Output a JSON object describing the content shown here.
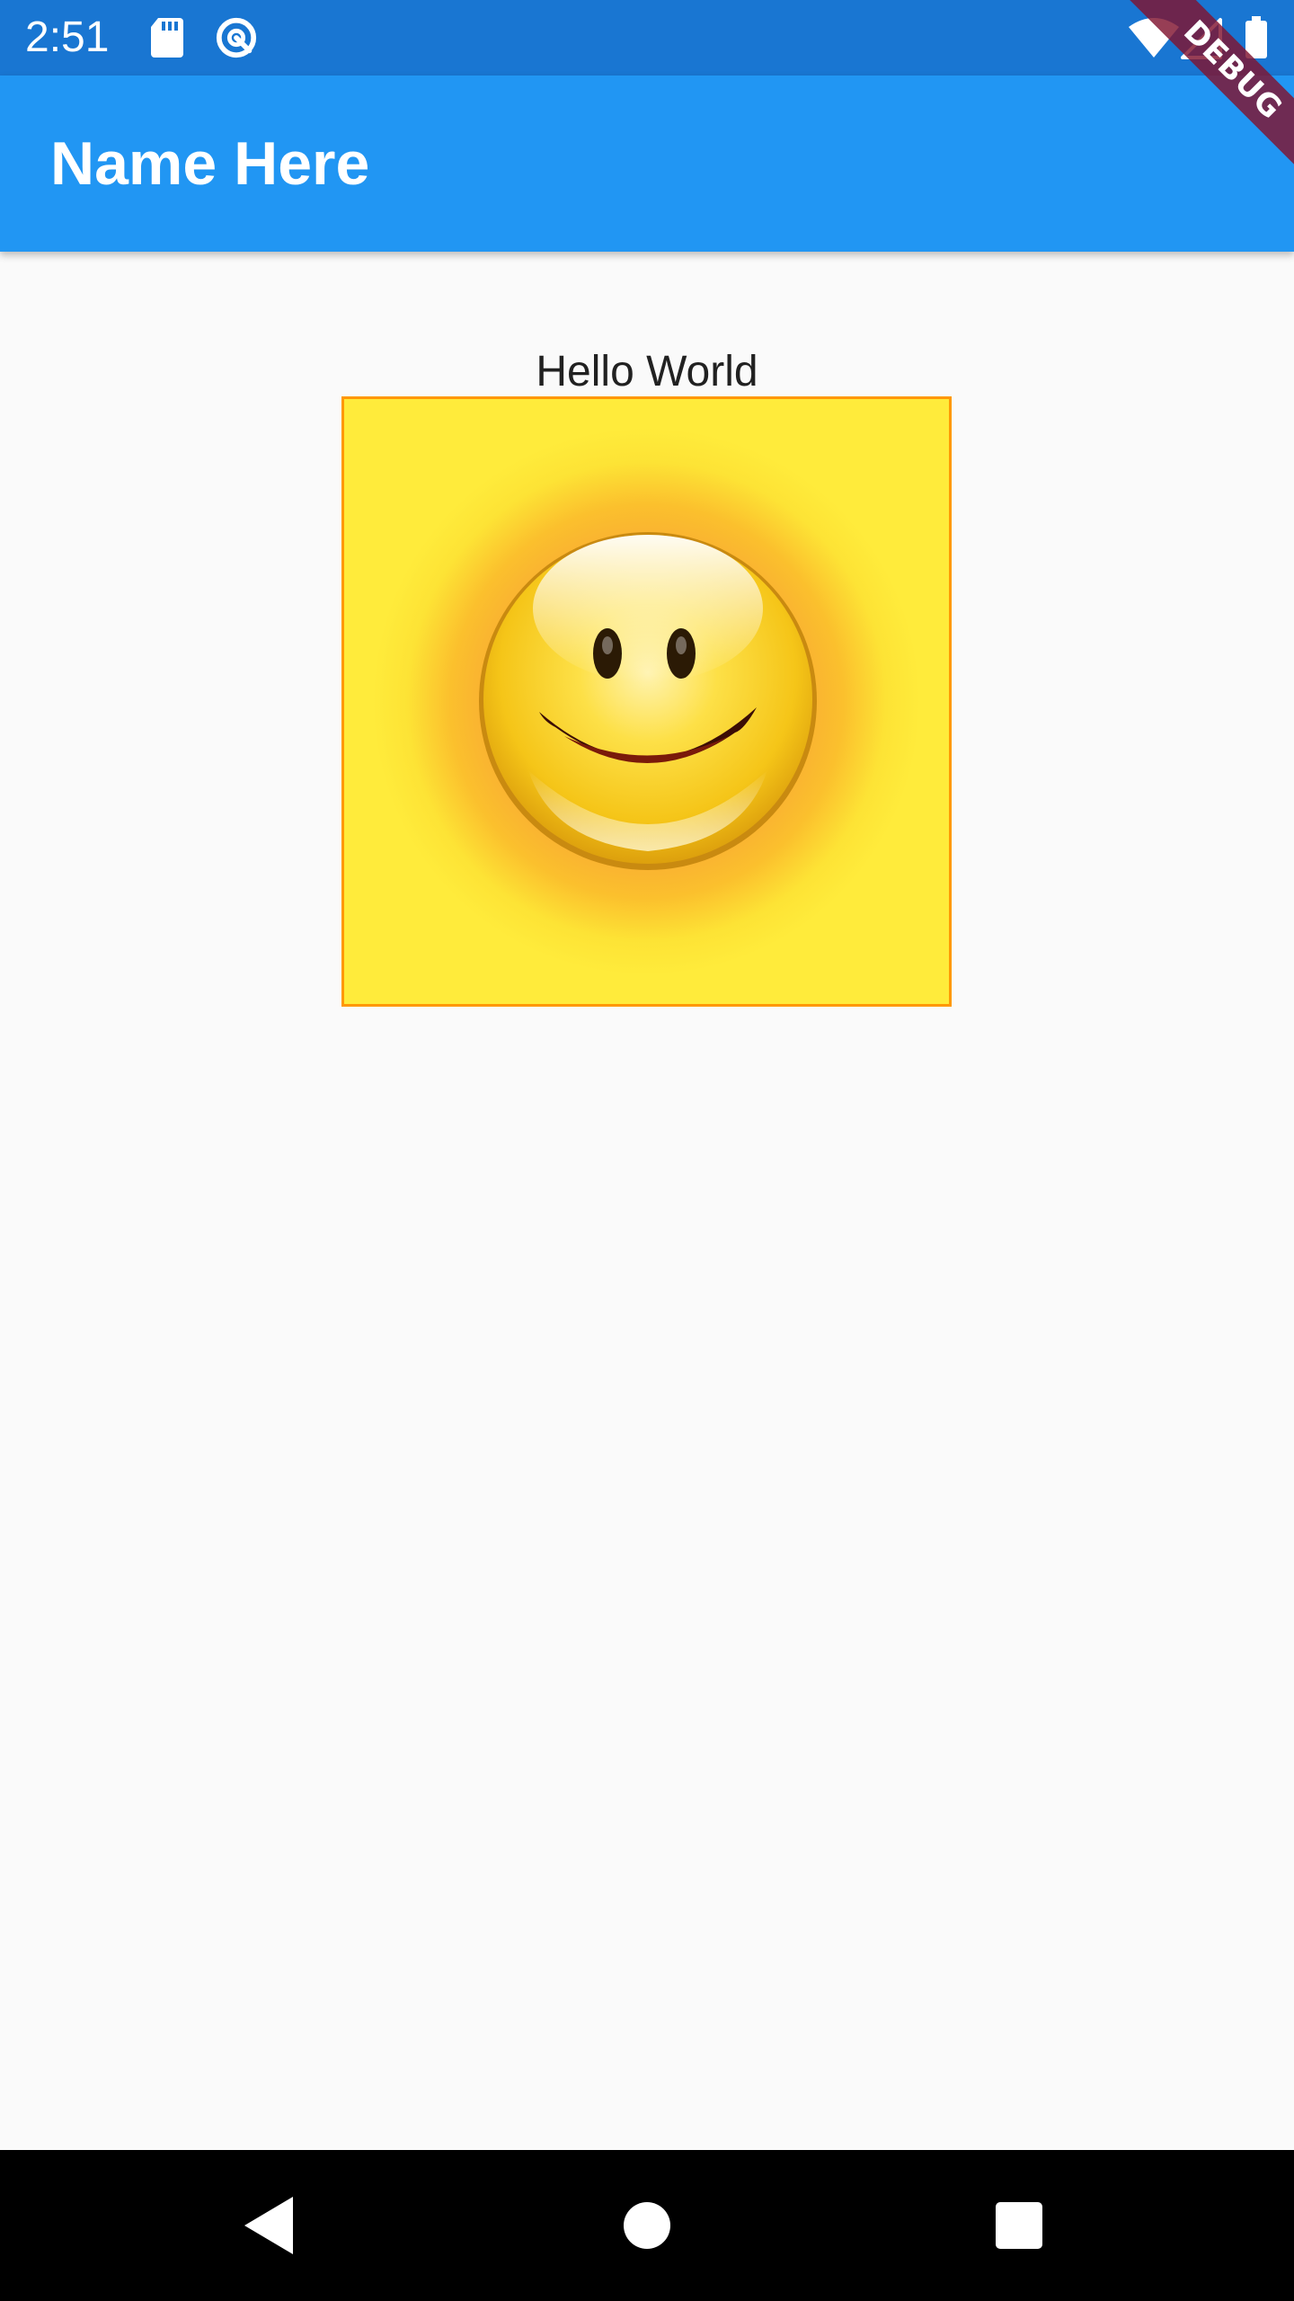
{
  "status_bar": {
    "time": "2:51",
    "background": "#1976d2",
    "icons_left": [
      "sd-card-icon",
      "sync-circle-icon"
    ],
    "icons_right": [
      "wifi-icon",
      "cell-signal-icon",
      "battery-icon"
    ]
  },
  "app_bar": {
    "title": "Name Here",
    "background": "#2196f3"
  },
  "debug_banner": {
    "label": "DEBUG",
    "color": "#801430"
  },
  "main": {
    "greeting": "Hello World",
    "image": {
      "icon": "smiley-face-icon",
      "border_color": "#ff9800",
      "background_color": "#ffeb3b"
    }
  },
  "nav_bar": {
    "buttons": [
      "back-icon",
      "home-icon",
      "recents-icon"
    ]
  }
}
